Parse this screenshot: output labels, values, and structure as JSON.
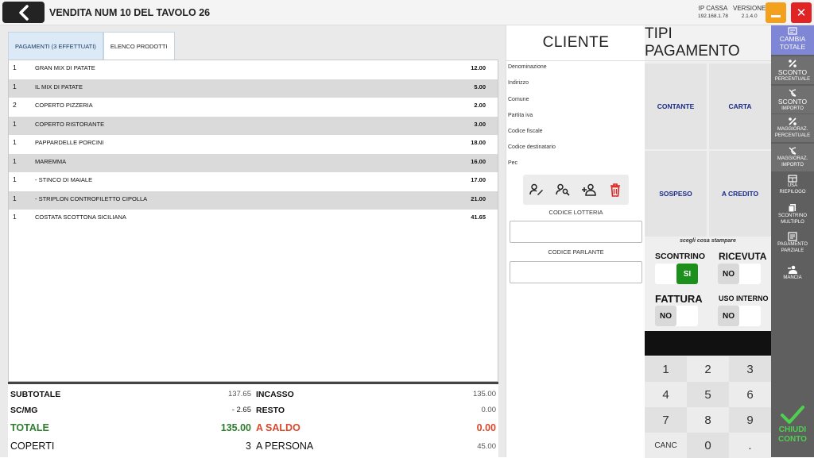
{
  "header": {
    "title": "VENDITA NUM 10 DEL TAVOLO 26",
    "ip_label": "IP CASSA",
    "ip_value": "192.168.1.78",
    "version_label": "VERSIONE",
    "version_value": "2.1.4.0",
    "close_glyph": "✕"
  },
  "tabs": [
    {
      "label": "PAGAMENTI (3 EFFETTUATI)",
      "active": true
    },
    {
      "label": "ELENCO PRODOTTI",
      "active": false
    }
  ],
  "products": [
    {
      "qty": "1",
      "name": "GRAN MIX DI PATATE",
      "price": "12.00"
    },
    {
      "qty": "1",
      "name": "IL MIX DI PATATE",
      "price": "5.00"
    },
    {
      "qty": "2",
      "name": "COPERTO PIZZERIA",
      "price": "2.00"
    },
    {
      "qty": "1",
      "name": "COPERTO RISTORANTE",
      "price": "3.00"
    },
    {
      "qty": "1",
      "name": "PAPPARDELLE PORCINI",
      "price": "18.00"
    },
    {
      "qty": "1",
      "name": "MAREMMA",
      "price": "16.00"
    },
    {
      "qty": "1",
      "name": "- STINCO DI MAIALE",
      "price": "17.00"
    },
    {
      "qty": "1",
      "name": "- STRIPLON CONTROFILETTO CIPOLLA",
      "price": "21.00"
    },
    {
      "qty": "1",
      "name": "COSTATA SCOTTONA SICILIANA",
      "price": "41.65"
    }
  ],
  "totals": {
    "subtotale_label": "SUBTOTALE",
    "subtotale": "137.65",
    "incasso_label": "INCASSO",
    "incasso": "135.00",
    "scmg_label": "SC/MG",
    "scmg": "- 2.65",
    "resto_label": "RESTO",
    "resto": "0.00",
    "totale_label": "TOTALE",
    "totale": "135.00",
    "a_saldo_label": "A SALDO",
    "a_saldo": "0.00",
    "coperti_label": "COPERTI",
    "coperti": "3",
    "a_persona_label": "A PERSONA",
    "a_persona": "45.00"
  },
  "cliente": {
    "title": "CLIENTE",
    "fields": [
      "Denominazione",
      "Indirizzo",
      "Comune",
      "Partita iva",
      "Codice fiscale",
      "Codice destinatario",
      "Pec"
    ],
    "codice_lotteria_label": "CODICE LOTTERIA",
    "codice_parlante_label": "CODICE PARLANTE"
  },
  "pagamento": {
    "title": "TIPI PAGAMENTO",
    "methods": [
      "CONTANTE",
      "CARTA",
      "SOSPESO",
      "A CREDITO"
    ],
    "print_prompt": "scegli cosa stampare",
    "options": [
      {
        "label": "SCONTRINO",
        "value": "SI"
      },
      {
        "label": "RICEVUTA",
        "value": "NO"
      },
      {
        "label": "FATTURA",
        "value": "NO"
      },
      {
        "label": "USO INTERNO",
        "value": "NO"
      }
    ],
    "keypad": [
      "1",
      "2",
      "3",
      "4",
      "5",
      "6",
      "7",
      "8",
      "9",
      "CANC",
      "0",
      "."
    ]
  },
  "sidebar": {
    "items": [
      {
        "line1": "CAMBIA",
        "line2": "TOTALE",
        "icon": "receipt-icon"
      },
      {
        "line1": "SCONTO",
        "line2": "PERCENTUALE",
        "icon": "percent-icon"
      },
      {
        "line1": "SCONTO",
        "line2": "IMPORTO",
        "icon": "discount-amount-icon"
      },
      {
        "line1": "MAGGIORAZ.",
        "line2": "PERCENTUALE",
        "icon": "percent-icon"
      },
      {
        "line1": "MAGGIORAZ.",
        "line2": "IMPORTO",
        "icon": "surcharge-amount-icon"
      },
      {
        "line1": "USA",
        "line2": "RIEPILOGO",
        "icon": "summary-icon"
      },
      {
        "line1": "SCONTRINO",
        "line2": "MULTIPLO",
        "icon": "multi-receipt-icon"
      },
      {
        "line1": "PAGAMENTO",
        "line2": "PARZIALE",
        "icon": "partial-payment-icon"
      },
      {
        "line1": "MANCIA",
        "line2": "",
        "icon": "tip-icon"
      }
    ],
    "chiudi_line1": "CHIUDI",
    "chiudi_line2": "CONTO"
  },
  "colors": {
    "accent_orange": "#f3a01d",
    "close_red": "#e02323",
    "sidebar_gray": "#5f5f5f",
    "active_sidebar": "#7f86d6",
    "toggle_green": "#1d8f1d",
    "total_green": "#2e7d2e",
    "saldo_red": "#d9472b",
    "payment_blue": "#1a2a8a"
  }
}
